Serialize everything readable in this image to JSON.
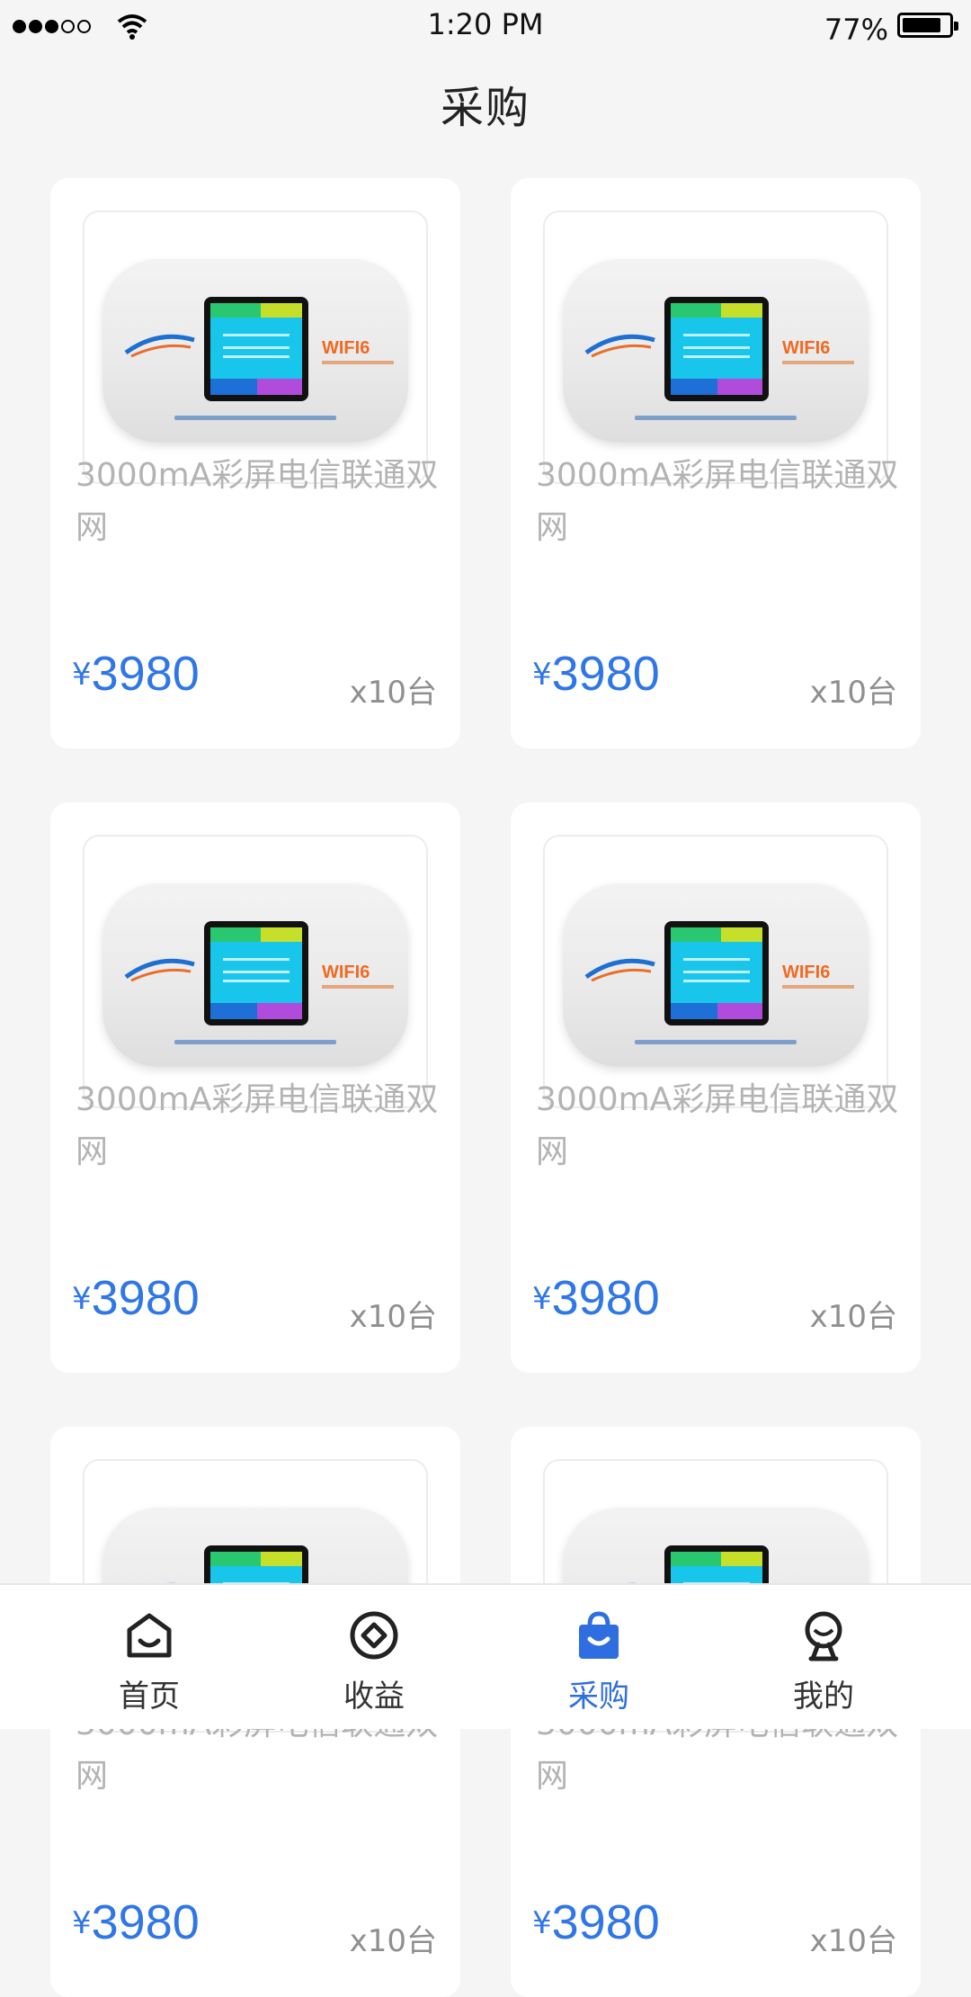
{
  "status_bar": {
    "time": "1:20 PM",
    "battery": "77%"
  },
  "page": {
    "title": "采购"
  },
  "products": [
    {
      "name": "3000mA彩屏电信联通双网",
      "price_symbol": "¥",
      "price": "3980",
      "qty": "x10台"
    },
    {
      "name": "3000mA彩屏电信联通双网",
      "price_symbol": "¥",
      "price": "3980",
      "qty": "x10台"
    },
    {
      "name": "3000mA彩屏电信联通双网",
      "price_symbol": "¥",
      "price": "3980",
      "qty": "x10台"
    },
    {
      "name": "3000mA彩屏电信联通双网",
      "price_symbol": "¥",
      "price": "3980",
      "qty": "x10台"
    },
    {
      "name": "3000mA彩屏电信联通双网",
      "price_symbol": "¥",
      "price": "3980",
      "qty": "x10台"
    },
    {
      "name": "3000mA彩屏电信联通双网",
      "price_symbol": "¥",
      "price": "3980",
      "qty": "x10台"
    }
  ],
  "device_image": {
    "brand_text": "WIFI6"
  },
  "tabbar": {
    "items": [
      {
        "label": "首页",
        "icon": "home-icon"
      },
      {
        "label": "收益",
        "icon": "earnings-icon"
      },
      {
        "label": "采购",
        "icon": "shopping-bag-icon"
      },
      {
        "label": "我的",
        "icon": "profile-icon"
      }
    ],
    "active_index": 2
  },
  "colors": {
    "accent": "#2f76e8",
    "background": "#f5f5f6",
    "card": "#ffffff",
    "muted_text": "#b3b3b3"
  }
}
